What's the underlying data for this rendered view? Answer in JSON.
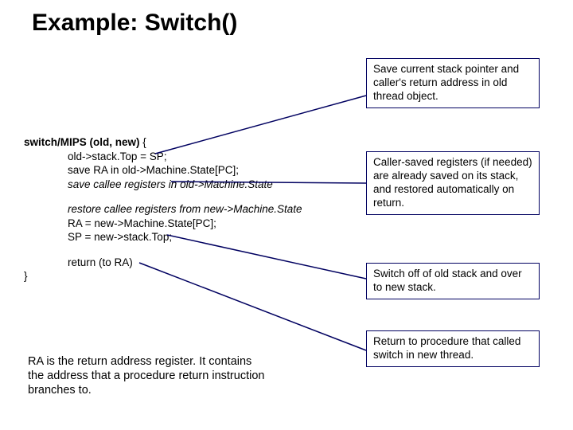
{
  "title": "Example: Switch()",
  "code": {
    "l1a": "switch/MIPS (old, new)",
    "l1b": " {",
    "l2": "old->stack.Top = SP;",
    "l3": "save RA in old->Machine.State[PC];",
    "l4": "save callee registers in old->Machine.State",
    "l5": "restore callee registers from new->Machine.State",
    "l6": "RA = new->Machine.State[PC];",
    "l7": "SP = new->stack.Top;",
    "l8": "return (to RA)",
    "l9": "}"
  },
  "box1": {
    "t1": "Save current stack pointer and caller's return address in ",
    "t2": "old",
    "t3": " thread object."
  },
  "box2": {
    "t1": "Caller-saved registers (if needed) are already saved on its stack, and restored automatically on return."
  },
  "box3": {
    "t1": "Switch off of ",
    "t2": "old",
    "t3": " stack and over to ",
    "t4": "new",
    "t5": " stack."
  },
  "box4": {
    "t1": "Return to procedure that called switch in ",
    "t2": "new",
    "t3": " thread",
    "t4": "."
  },
  "ra_note": {
    "t1": "RA is the ",
    "t2": "return address",
    "t3": " register.  It contains the address that a procedure ",
    "t4": "return",
    "t5": " instruction branches to."
  }
}
